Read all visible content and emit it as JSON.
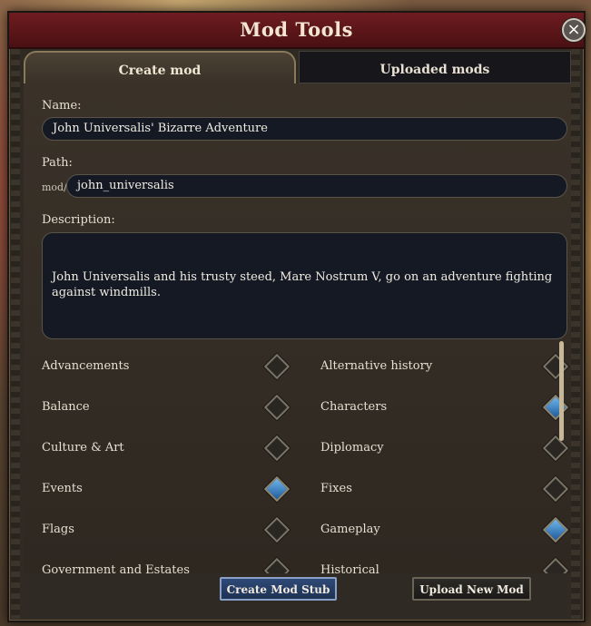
{
  "window": {
    "title": "Mod Tools",
    "close_glyph": "×"
  },
  "tabs": [
    {
      "label": "Create mod",
      "active": true
    },
    {
      "label": "Uploaded mods",
      "active": false
    }
  ],
  "form": {
    "name_label": "Name:",
    "name_value": "John Universalis' Bizarre Adventure",
    "path_label": "Path:",
    "path_prefix": "mod/",
    "path_value": "john_universalis",
    "description_label": "Description:",
    "description_value": "John Universalis and his trusty steed, Mare Nostrum V, go on an adventure fighting against windmills."
  },
  "tags": [
    {
      "label": "Advancements",
      "checked": false
    },
    {
      "label": "Alternative history",
      "checked": false
    },
    {
      "label": "Balance",
      "checked": false
    },
    {
      "label": "Characters",
      "checked": true
    },
    {
      "label": "Culture & Art",
      "checked": false
    },
    {
      "label": "Diplomacy",
      "checked": false
    },
    {
      "label": "Events",
      "checked": true
    },
    {
      "label": "Fixes",
      "checked": false
    },
    {
      "label": "Flags",
      "checked": false
    },
    {
      "label": "Gameplay",
      "checked": true
    },
    {
      "label": "Government and Estates",
      "checked": false
    },
    {
      "label": "Historical",
      "checked": false
    }
  ],
  "buttons": {
    "create_stub": "Create Mod Stub",
    "upload_new": "Upload New Mod"
  },
  "colors": {
    "title_bar": "#5a1418",
    "checked": "#3d86c6",
    "primary_button": "#2a4168"
  }
}
